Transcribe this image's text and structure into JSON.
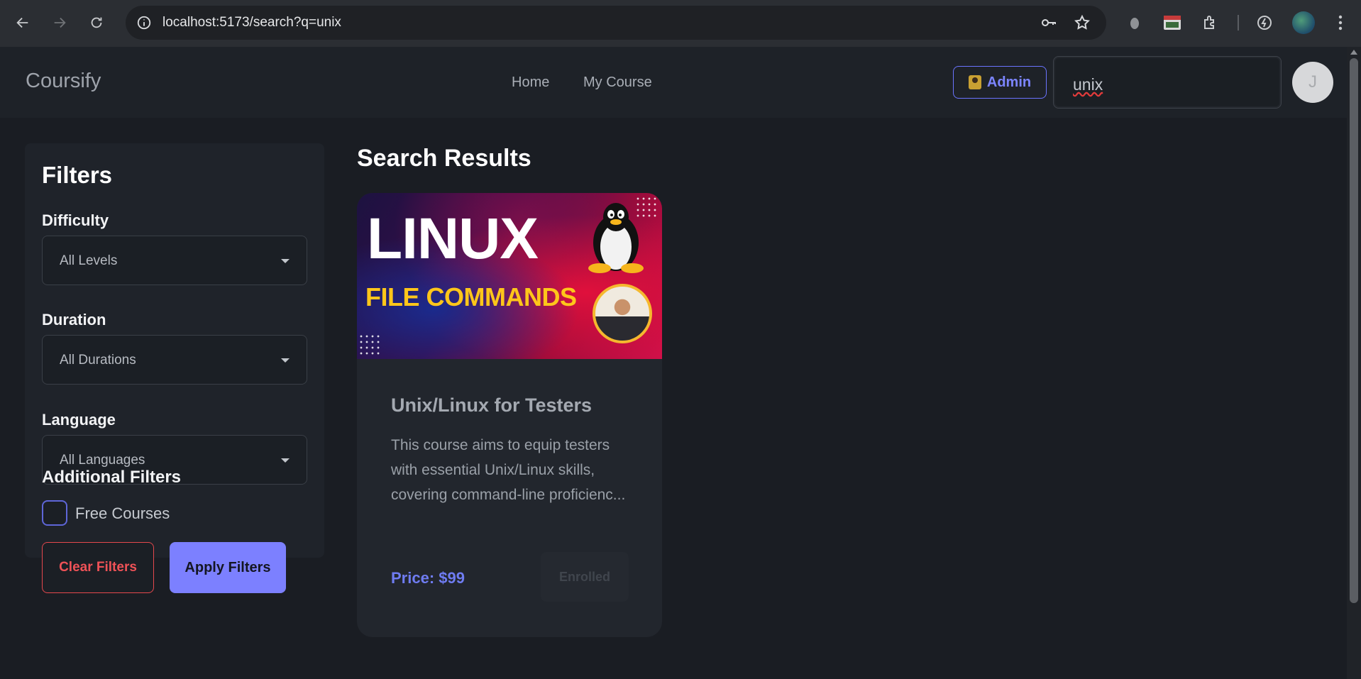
{
  "browser": {
    "url": "localhost:5173/search?q=unix",
    "icons": [
      "back-icon",
      "forward-icon",
      "reload-icon",
      "site-info-icon",
      "key-icon",
      "star-icon",
      "extension-icon",
      "puzzle-icon",
      "performance-icon",
      "profile-avatar",
      "menu-icon"
    ]
  },
  "header": {
    "brand": "Coursify",
    "nav": [
      "Home",
      "My Course"
    ],
    "admin_label": "Admin",
    "search_value": "unix",
    "avatar_initial": "J"
  },
  "filters": {
    "title": "Filters",
    "difficulty": {
      "label": "Difficulty",
      "value": "All Levels"
    },
    "duration": {
      "label": "Duration",
      "value": "All Durations"
    },
    "language": {
      "label": "Language",
      "value": "All Languages"
    },
    "additional_label": "Additional Filters",
    "free_courses_label": "Free Courses",
    "free_courses_checked": false,
    "clear_label": "Clear Filters",
    "apply_label": "Apply Filters"
  },
  "results": {
    "title": "Search Results",
    "courses": [
      {
        "thumbnail_line1": "LINUX",
        "thumbnail_line2": "FILE COMMANDS",
        "title": "Unix/Linux for Testers",
        "description": "This course aims to equip testers with essential Unix/Linux skills, covering command-line proficienc...",
        "price": "Price: $99",
        "status_label": "Enrolled"
      }
    ]
  },
  "colors": {
    "accent": "#7c80ff",
    "danger": "#e5484d",
    "background": "#1a1d23",
    "panel": "#1f232a"
  }
}
